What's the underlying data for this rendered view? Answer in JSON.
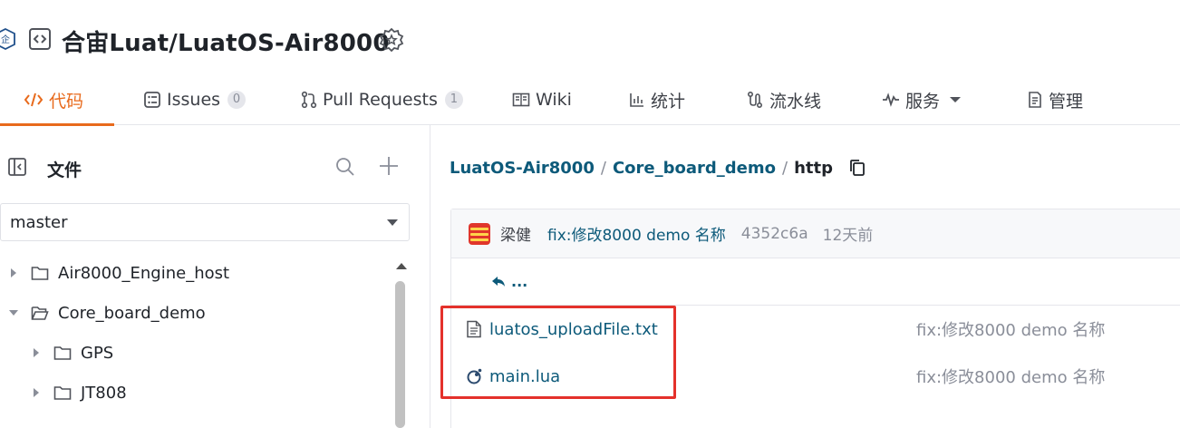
{
  "header": {
    "repo_title": "合宙Luat/LuatOS-Air8000",
    "icons": [
      "enterprise-icon",
      "code-repo-icon",
      "award-badge-icon"
    ]
  },
  "tabs": [
    {
      "label": "代码",
      "icon": "code-icon",
      "active": true
    },
    {
      "label": "Issues",
      "icon": "issues-icon",
      "count": "0"
    },
    {
      "label": "Pull Requests",
      "icon": "pull-request-icon",
      "count": "1"
    },
    {
      "label": "Wiki",
      "icon": "wiki-icon"
    },
    {
      "label": "统计",
      "icon": "stats-icon"
    },
    {
      "label": "流水线",
      "icon": "pipeline-icon"
    },
    {
      "label": "服务",
      "icon": "service-icon",
      "dropdown": true
    },
    {
      "label": "管理",
      "icon": "manage-icon"
    }
  ],
  "sidebar": {
    "title": "文件",
    "branch": "master",
    "tree": [
      {
        "label": "Air8000_Engine_host",
        "expanded": false,
        "depth": 0
      },
      {
        "label": "Core_board_demo",
        "expanded": true,
        "depth": 0
      },
      {
        "label": "GPS",
        "expanded": false,
        "depth": 1
      },
      {
        "label": "JT808",
        "expanded": false,
        "depth": 1
      }
    ]
  },
  "breadcrumb": {
    "root": "LuatOS-Air8000",
    "parent": "Core_board_demo",
    "current": "http",
    "separator": "/"
  },
  "commit": {
    "author": "梁健",
    "message": "fix:修改8000 demo 名称",
    "sha": "4352c6a",
    "time": "12天前"
  },
  "parent_dir": {
    "label": "..."
  },
  "files": [
    {
      "name": "luatos_uploadFile.txt",
      "icon": "text-file-icon",
      "commit_msg": "fix:修改8000 demo 名称"
    },
    {
      "name": "main.lua",
      "icon": "lua-file-icon",
      "commit_msg": "fix:修改8000 demo 名称"
    }
  ],
  "colors": {
    "accent": "#e86a1c",
    "link": "#0d5a7a",
    "highlight_box": "#e4312b",
    "muted_text": "#8a8e99"
  }
}
